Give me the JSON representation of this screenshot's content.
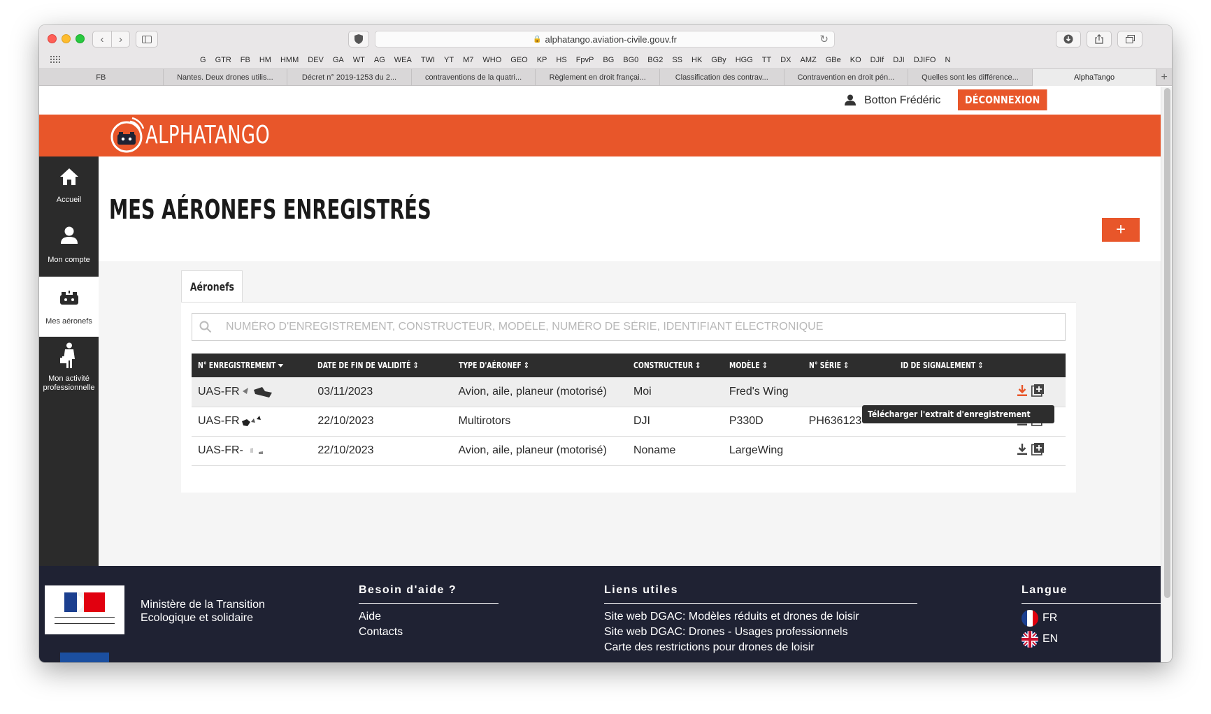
{
  "browser": {
    "url": "alphatango.aviation-civile.gouv.fr",
    "bookmarks": [
      "G",
      "GTR",
      "FB",
      "HM",
      "HMM",
      "DEV",
      "GA",
      "WT",
      "AG",
      "WEA",
      "TWI",
      "YT",
      "M7",
      "WHO",
      "GEO",
      "KP",
      "HS",
      "FpvP",
      "BG",
      "BG0",
      "BG2",
      "SS",
      "HK",
      "GBy",
      "HGG",
      "TT",
      "DX",
      "AMZ",
      "GBe",
      "KO",
      "DJIf",
      "DJI",
      "DJIFO",
      "N"
    ],
    "tabs": [
      "FB",
      "Nantes. Deux drones utilis...",
      "Décret n° 2019-1253 du 2...",
      "contraventions de la quatri...",
      "Règlement en droit françai...",
      "Classification des contrav...",
      "Contravention en droit pén...",
      "Quelles sont les différence...",
      "AlphaTango"
    ],
    "active_tab": 8
  },
  "userbar": {
    "user_name": "Botton Frédéric",
    "logout_label": "DÉCONNEXION"
  },
  "brand": {
    "name": "ALPHATANGO",
    "accent_color": "#e8562a"
  },
  "leftnav": {
    "items": [
      {
        "label": "Accueil",
        "icon": "home-icon"
      },
      {
        "label": "Mon compte",
        "icon": "user-icon"
      },
      {
        "label": "Mes aéronefs",
        "icon": "drone-icon"
      },
      {
        "label": "Mon activité professionnelle",
        "icon": "professional-icon"
      }
    ],
    "active": 2
  },
  "main": {
    "title": "MES AÉRONEFS ENREGISTRÉS",
    "add_button_label": "+",
    "tab_label": "Aéronefs",
    "search_placeholder": "NUMÉRO D'ENREGISTREMENT, CONSTRUCTEUR, MODÈLE, NUMÉRO DE SÉRIE, IDENTIFIANT ÉLECTRONIQUE",
    "search_value": "",
    "columns": [
      "N° ENREGISTREMENT",
      "DATE DE FIN DE VALIDITÉ",
      "TYPE D'AÉRONEF",
      "CONSTRUCTEUR",
      "MODÈLE",
      "N° SÉRIE",
      "ID DE SIGNALEMENT"
    ],
    "rows": [
      {
        "registration": "UAS-FR",
        "end_date": "03/11/2023",
        "type": "Avion, aile, planeur (motorisé)",
        "maker": "Moi",
        "model": "Fred's Wing",
        "serial": "",
        "signal_id": ""
      },
      {
        "registration": "UAS-FR",
        "end_date": "22/10/2023",
        "type": "Multirotors",
        "maker": "DJI",
        "model": "P330D",
        "serial": "PH636123",
        "signal_id": ""
      },
      {
        "registration": "UAS-FR-",
        "end_date": "22/10/2023",
        "type": "Avion, aile, planeur (motorisé)",
        "maker": "Noname",
        "model": "LargeWing",
        "serial": "",
        "signal_id": ""
      }
    ],
    "tooltip": "Télécharger l'extrait d'enregistrement"
  },
  "footer": {
    "logo_text": "Liberté • Égalité • Fraternité RÉPUBLIQUE FRANÇAISE",
    "ministry": "Ministère de la Transition Ecologique et solidaire",
    "help_title": "Besoin d'aide ?",
    "help_links": [
      "Aide",
      "Contacts"
    ],
    "links_title": "Liens utiles",
    "links": [
      "Site web DGAC: Modèles réduits et drones de loisir",
      "Site web DGAC: Drones - Usages professionnels",
      "Carte des restrictions pour drones de loisir"
    ],
    "lang_title": "Langue",
    "languages": [
      "FR",
      "EN"
    ]
  }
}
